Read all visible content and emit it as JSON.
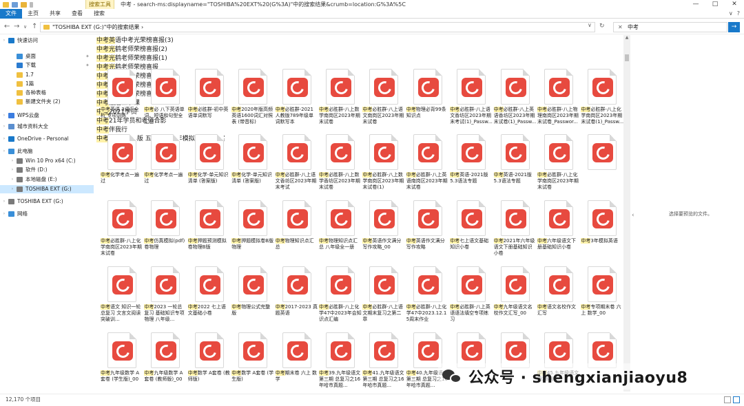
{
  "window": {
    "title": "中考 - search-ms:displayname=\"TOSHIBA%20EXT%20(G%3A)\"中的搜索结果&crumb=location:G%3A%5C",
    "contextual_tab": "搜索工具",
    "controls": [
      "—",
      "□",
      "✕"
    ]
  },
  "ribbon": {
    "tabs": [
      "文件",
      "主页",
      "共享",
      "查看",
      "搜索"
    ],
    "right_icons": [
      "∨",
      "?"
    ]
  },
  "address": {
    "path": "\"TOSHIBA EXT (G:)\"中的搜索结果  ›",
    "search_value": "中考",
    "search_clear": "✕",
    "search_go": "→",
    "nav": [
      "←",
      "→",
      "∨",
      "↑"
    ],
    "refresh": "↻",
    "dropdown": "∨"
  },
  "nav_pane": {
    "items": [
      {
        "label": "快速访问",
        "level": 0,
        "icon": "star-icon",
        "color": "#1979ca"
      },
      {
        "label": "桌面",
        "level": 1,
        "icon": "desktop-icon",
        "color": "#3a8fd8",
        "pin": true
      },
      {
        "label": "下载",
        "level": 1,
        "icon": "download-icon",
        "color": "#2a7bd0",
        "pin": true
      },
      {
        "label": "1.7",
        "level": 1,
        "icon": "folder-icon",
        "color": "#f0c040"
      },
      {
        "label": "1篇",
        "level": 1,
        "icon": "folder-icon",
        "color": "#f0c040"
      },
      {
        "label": "各种表格",
        "level": 1,
        "icon": "folder-icon",
        "color": "#f0c040"
      },
      {
        "label": "新建文件夹 (2)",
        "level": 1,
        "icon": "folder-icon",
        "color": "#f0c040"
      },
      {
        "label": "WPS云盘",
        "level": 0,
        "icon": "cloud-icon",
        "color": "#3b7de0"
      },
      {
        "label": "城市资料大全",
        "level": 0,
        "icon": "drive-icon",
        "color": "#5b8fcf"
      },
      {
        "label": "OneDrive - Personal",
        "level": 0,
        "icon": "onedrive-icon",
        "color": "#1979ca"
      },
      {
        "label": "此电脑",
        "level": 0,
        "icon": "pc-icon",
        "color": "#3a8fd8"
      },
      {
        "label": "Win 10 Pro x64 (C:)",
        "level": 1,
        "icon": "drive-icon",
        "color": "#7a7a7a"
      },
      {
        "label": "软件 (D:)",
        "level": 1,
        "icon": "drive-icon",
        "color": "#7a7a7a"
      },
      {
        "label": "本地磁盘 (E:)",
        "level": 1,
        "icon": "drive-icon",
        "color": "#7a7a7a"
      },
      {
        "label": "TOSHIBA EXT (G:)",
        "level": 1,
        "icon": "drive-icon",
        "color": "#7a7a7a",
        "selected": true
      },
      {
        "label": "TOSHIBA EXT (G:)",
        "level": 0,
        "icon": "drive-icon",
        "color": "#7a7a7a"
      },
      {
        "label": "网络",
        "level": 0,
        "icon": "network-icon",
        "color": "#3a8fd8"
      }
    ]
  },
  "top_captions": [
    {
      "h": "中考英",
      "t": "语中考光荣榜喜报(3)"
    },
    {
      "h": "中考光",
      "t": "鹤老师荣榜喜报(2)"
    },
    {
      "h": "中考光",
      "t": "鹤老师荣榜喜报(1)"
    },
    {
      "h": "中考光",
      "t": "鹤老师荣榜喜报"
    },
    {
      "h": "中考光",
      "t": "鹤老师荣榜喜报"
    },
    {
      "h": "中考光",
      "t": "鹤老师荣榜喜报(1)"
    },
    {
      "h": "中考光",
      "t": "鹤老师荣榜喜报"
    },
    {
      "h": "中考",
      "t": "最后五节课"
    },
    {
      "h": "中考",
      "t": "2021学员"
    },
    {
      "h": "中考",
      "t": "21年学员和老师合影"
    },
    {
      "h": "中考",
      "t": "伴我行"
    },
    {
      "h": "中考",
      "t": "英语2024版 五年真题五年模拟英语+答案"
    }
  ],
  "rows": [
    [
      {
        "h": "中考",
        "t": "英语  3词汇全析 专项训练"
      },
      {
        "h": "中考",
        "t": "必  八下英语单词、短语和句型全汇总"
      },
      {
        "h": "中考",
        "t": "必胜群-初中英语单词默写"
      },
      {
        "h": "中考",
        "t": "2020年版高频英语1600词汇对照表 (带音标)"
      },
      {
        "h": "中考",
        "t": "必胜群-2021人教版789年级单词默写本"
      },
      {
        "h": "中考",
        "t": "必胜群-八上数学南岗区2023年期末试卷"
      },
      {
        "h": "中考",
        "t": "必胜群-八上语文南岗区2023年期末试卷"
      },
      {
        "h": "中考",
        "t": "物理必背99条知识点"
      },
      {
        "h": "中考",
        "t": "必胜群-八上语文香坊区2023年期末考试(1)_Passw..."
      },
      {
        "h": "中考",
        "t": "必胜群-八上英语香坊区2023年期末试卷(1)_Passw..."
      },
      {
        "h": "中考",
        "t": "必胜群-八上物理南岗区2023年期末试卷_Passwor..."
      },
      {
        "h": "中考",
        "t": "必胜群-八上化学南岗区2023年期末试卷(1)_Passw..."
      }
    ],
    [
      {
        "h": "中考",
        "t": "化学考点一遍过"
      },
      {
        "h": "中考",
        "t": "化学考点一遍过"
      },
      {
        "h": "中考",
        "t": "化学-单元知识清单 (答案版)"
      },
      {
        "h": "中考",
        "t": "化学-单元知识清单 (答案版)"
      },
      {
        "h": "中考",
        "t": "必胜群-八上语文香坊区2023年期末考试"
      },
      {
        "h": "中考",
        "t": "必胜群-八上数学香坊区2023年期末试卷"
      },
      {
        "h": "中考",
        "t": "必胜群-八上数学南岗区2023年期末试卷(1)"
      },
      {
        "h": "中考",
        "t": "必胜群-八上英语南岗区2023年期末试卷"
      },
      {
        "h": "中考",
        "t": "英语-2021版5.3语法专题"
      },
      {
        "h": "中考",
        "t": "英语-2021版5.3语法专题"
      },
      {
        "h": "中考",
        "t": "必胜群-八上化学南岗区2023年期末试卷"
      },
      {
        "h": "",
        "t": ""
      }
    ],
    [
      {
        "h": "中考",
        "t": "必胜群-八上化学南岗区2023年期末试卷"
      },
      {
        "h": "中考",
        "t": "仿真模拟(pdf)卷物理"
      },
      {
        "h": "中考",
        "t": "押题预测模拟卷物理B版"
      },
      {
        "h": "中考",
        "t": "押题模拟卷B版物理"
      },
      {
        "h": "中考",
        "t": "物理知识点汇总"
      },
      {
        "h": "中考",
        "t": "物理知识点汇总 八年级全一册"
      },
      {
        "h": "中考",
        "t": "英语作文满分写作攻略_00"
      },
      {
        "h": "中考",
        "t": "英语作文满分写作攻略"
      },
      {
        "h": "中考",
        "t": "七上语文基础知识小卷"
      },
      {
        "h": "中考",
        "t": "2021年六年级语文下册基础知识小卷"
      },
      {
        "h": "中考",
        "t": "六年级语文下册基础知识小卷"
      },
      {
        "h": "中考",
        "t": "3年模拟英语"
      }
    ],
    [
      {
        "h": "中考",
        "t": "语文 知识一轮总复习 文言文阅读突破训..."
      },
      {
        "h": "中考",
        "t": "2023 一轮总复习 基础知识专项 物理 八年级..."
      },
      {
        "h": "中考",
        "t": "2022 七上语文基础小卷"
      },
      {
        "h": "中考",
        "t": "物理公式完整版"
      },
      {
        "h": "中考",
        "t": "2017-2023 真题英语"
      },
      {
        "h": "中考",
        "t": "必胜群-八上化学47中2023年会知识点汇编"
      },
      {
        "h": "中考",
        "t": "必胜群-八上语文期末复习之第二章"
      },
      {
        "h": "中考",
        "t": "必胜群-八上化学47中2023.12.15周末作业"
      },
      {
        "h": "中考",
        "t": "必胜群-八上英语语法填空专项练习"
      },
      {
        "h": "中考",
        "t": "九年级语文名校作文汇写_00"
      },
      {
        "h": "中考",
        "t": "语文名校作文汇写"
      },
      {
        "h": "中考",
        "t": "专项期末卷 六上 数学_00"
      }
    ],
    [
      {
        "h": "中考",
        "t": "九年级数学 A套卷 (学生版)_00"
      },
      {
        "h": "中考",
        "t": "九年级数学 A套卷 (教师版)_00"
      },
      {
        "h": "中考",
        "t": "数学 A套卷 (教师版)"
      },
      {
        "h": "中考",
        "t": "数学 A套卷 (学生版)"
      },
      {
        "h": "中考",
        "t": "期末卷 六上 数学"
      },
      {
        "h": "中考",
        "t": "39.九年级语文第三期 总复习之16年哈市真题..."
      },
      {
        "h": "中考",
        "t": "41.九年级语文第三期 总复习之16年哈市真题..."
      },
      {
        "h": "中考",
        "t": "40.九年级语文第三期 总复习之16年哈市真题..."
      },
      {
        "h": "",
        "t": ""
      },
      {
        "h": "",
        "t": ""
      },
      {
        "h": "中考",
        "t": "45.九年级语文第28期 ..."
      },
      {
        "h": "",
        "t": ""
      }
    ]
  ],
  "preview": {
    "message": "选择要预览的文件。"
  },
  "status": {
    "count": "12,170 个项目"
  },
  "watermark": {
    "text": "公众号 · shengxianjiaoyu8"
  }
}
